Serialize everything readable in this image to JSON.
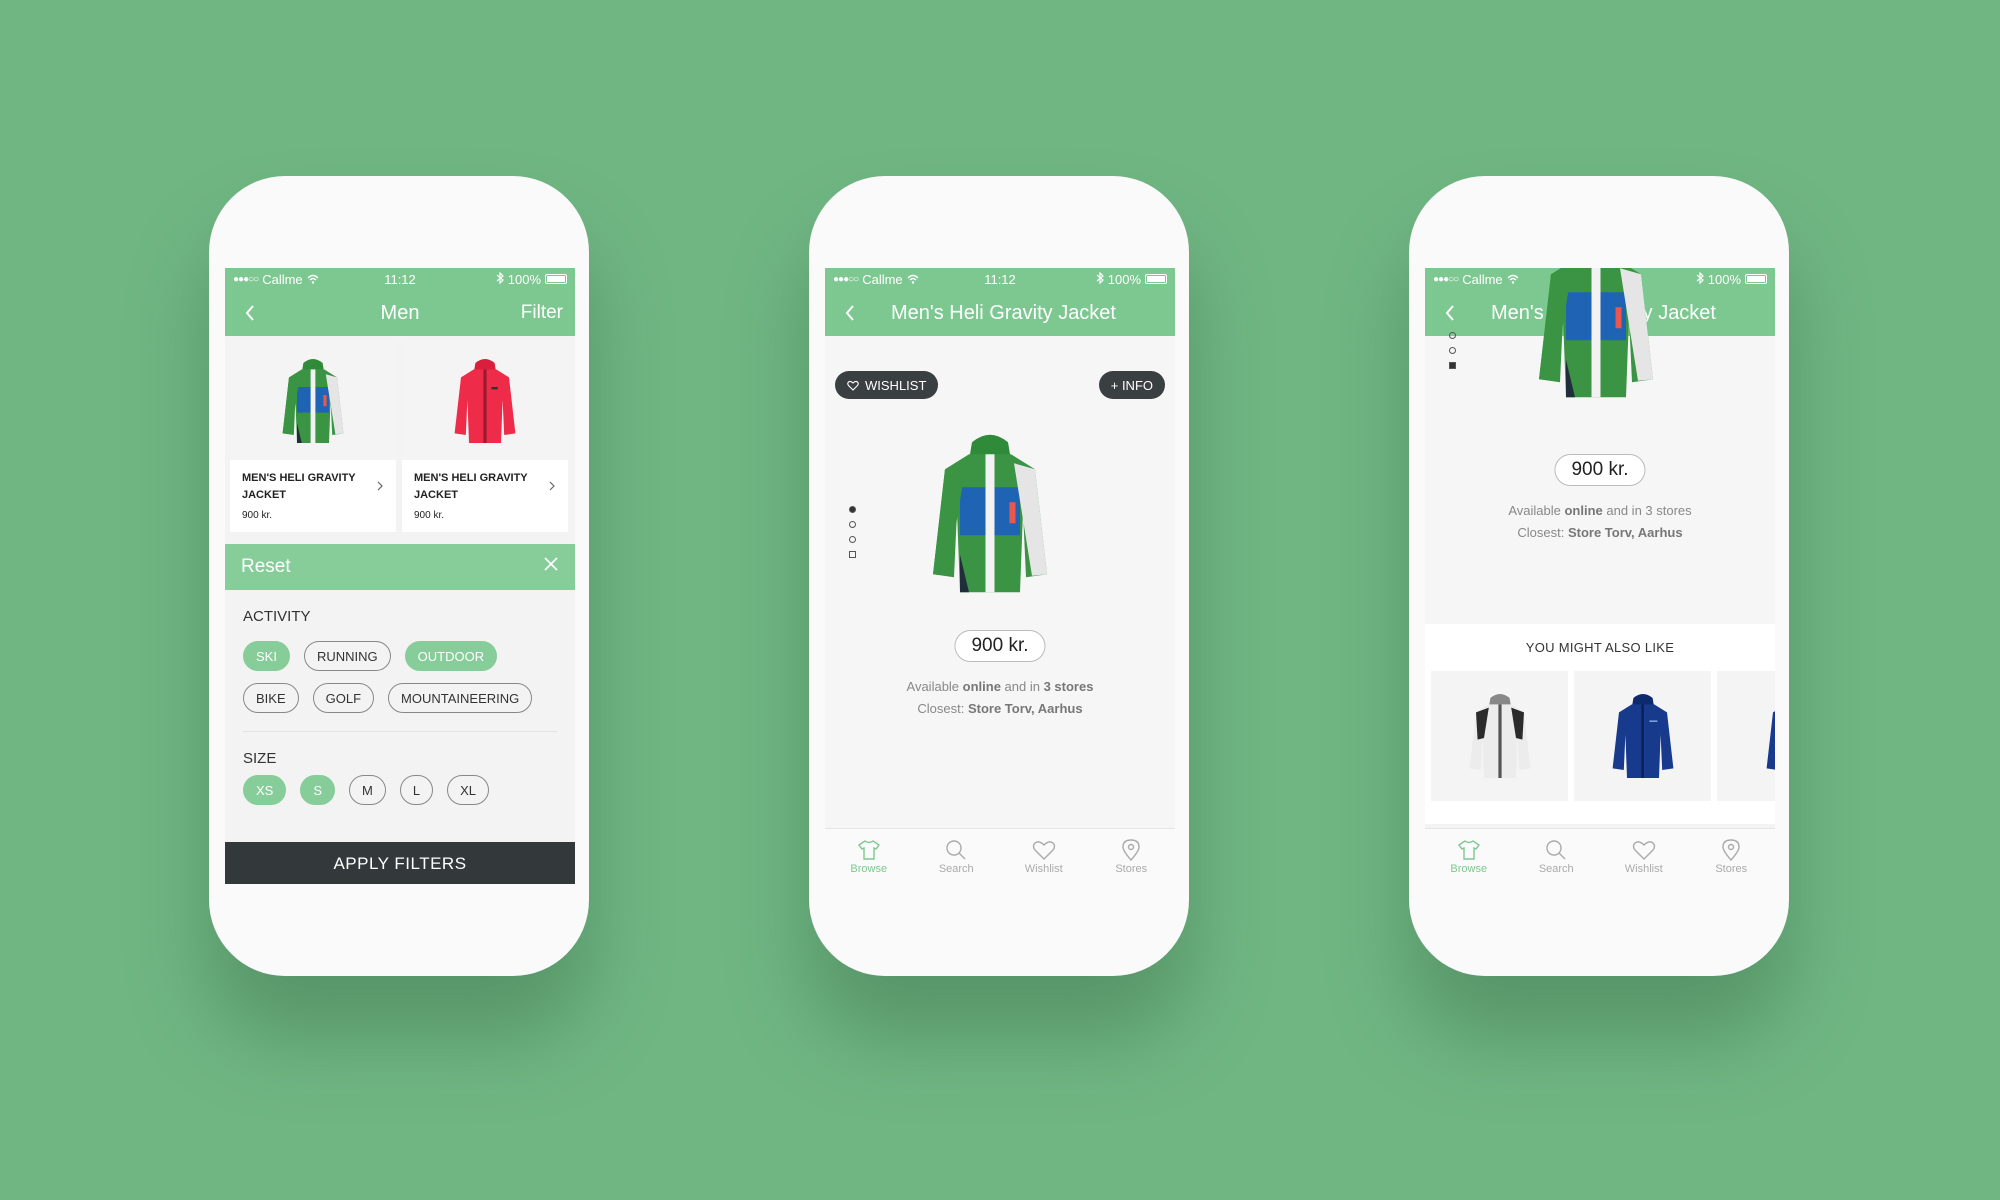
{
  "status": {
    "carrier": "Callme",
    "time": "11:12",
    "battery": "100%"
  },
  "colors": {
    "background": "#70b683",
    "accent": "#7dc891",
    "dark": "#33393b"
  },
  "phone1": {
    "nav_title": "Men",
    "filter_label": "Filter",
    "products": [
      {
        "name": "MEN'S HELI GRAVITY JACKET",
        "price": "900 kr.",
        "image": "green-blue-jacket"
      },
      {
        "name": "MEN'S HELI GRAVITY JACKET",
        "price": "900 kr.",
        "image": "red-jacket"
      }
    ],
    "reset_label": "Reset",
    "activity_title": "ACTIVITY",
    "activities": [
      {
        "label": "SKI",
        "selected": true
      },
      {
        "label": "RUNNING",
        "selected": false
      },
      {
        "label": "OUTDOOR",
        "selected": true
      },
      {
        "label": "BIKE",
        "selected": false
      },
      {
        "label": "GOLF",
        "selected": false
      },
      {
        "label": "MOUNTAINEERING",
        "selected": false
      }
    ],
    "size_title": "SIZE",
    "sizes": [
      {
        "label": "XS",
        "selected": true
      },
      {
        "label": "S",
        "selected": true
      },
      {
        "label": "M",
        "selected": false
      },
      {
        "label": "L",
        "selected": false
      },
      {
        "label": "XL",
        "selected": false
      }
    ],
    "apply_label": "APPLY FILTERS"
  },
  "phone2": {
    "nav_title": "Men's Heli Gravity Jacket",
    "wishlist_label": "WISHLIST",
    "info_label": "+ INFO",
    "price": "900 kr.",
    "avail_prefix": "Available ",
    "avail_online": "online",
    "avail_mid": " and in ",
    "avail_stores": "3 stores",
    "closest_prefix": "Closest: ",
    "closest_store": "Store Torv, Aarhus"
  },
  "phone3": {
    "nav_title": "Men's Heli Gravity Jacket",
    "price": "900 kr.",
    "avail_prefix": "Available ",
    "avail_online": "online",
    "avail_rest": " and in 3 stores",
    "closest_prefix": "Closest: ",
    "closest_store": "Store Torv, Aarhus",
    "also_like_title": "YOU MIGHT ALSO LIKE",
    "suggestions": [
      "white-black-jacket",
      "navy-jacket",
      "navy-jacket-partial"
    ]
  },
  "tabs": [
    {
      "label": "Browse",
      "icon": "shirt-icon",
      "active": true
    },
    {
      "label": "Search",
      "icon": "search-icon",
      "active": false
    },
    {
      "label": "Wishlist",
      "icon": "heart-icon",
      "active": false
    },
    {
      "label": "Stores",
      "icon": "location-pin-icon",
      "active": false
    }
  ]
}
